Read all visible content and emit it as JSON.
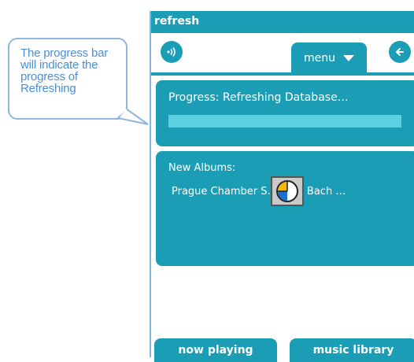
{
  "callout": {
    "text": "The progress bar will indicate the progress of Refreshing"
  },
  "window": {
    "title": "refresh"
  },
  "navbar": {
    "sound_icon": "sound-icon",
    "menu_label": "menu",
    "back_icon": "back-arrow-icon"
  },
  "progress": {
    "label": "Progress: Refreshing Database…",
    "fraction": 0
  },
  "albums": {
    "heading": "New Albums:",
    "items": [
      "Prague Chamber S… - J.S. Bach …"
    ]
  },
  "busy_icon": "busy-clock-icon",
  "bottom_bar": {
    "now_playing_label": "now playing",
    "music_library_label": "music library"
  },
  "colors": {
    "accent": "#1b9eb5",
    "callout_text": "#4a90d9",
    "callout_border": "#8fb7dc",
    "progress_track": "#5ccfe0"
  }
}
